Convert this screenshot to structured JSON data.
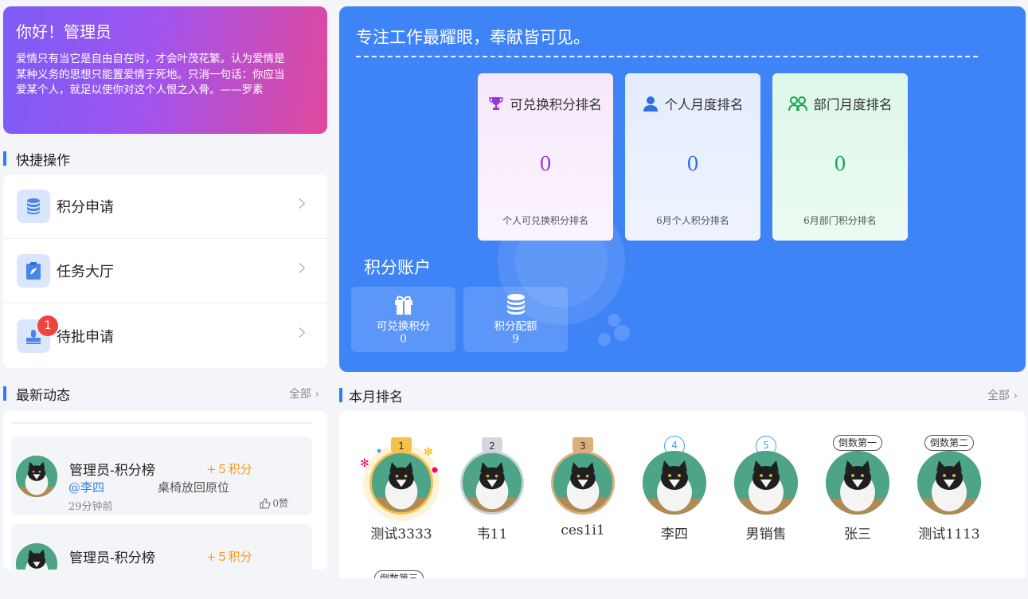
{
  "greeting": {
    "title": "你好！管理员",
    "quote": "爱情只有当它是自由自在时，才会叶茂花繁。认为爱情是某种义务的思想只能置爱情于死地。只消一句话：你应当爱某个人，就足以使你对这个人恨之入骨。——罗素"
  },
  "quick": {
    "title": "快捷操作",
    "items": [
      {
        "label": "积分申请",
        "icon": "database-icon"
      },
      {
        "label": "任务大厅",
        "icon": "task-icon"
      },
      {
        "label": "待批申请",
        "icon": "stamp-icon",
        "badge": "1"
      }
    ]
  },
  "news": {
    "title": "最新动态",
    "more": "全部",
    "items": [
      {
        "name": "管理员-积分榜",
        "points": "+５积分",
        "mention": "@李四",
        "content": "桌椅放回原位",
        "time": "29分钟前",
        "likes": "0赞"
      },
      {
        "name": "管理员-积分榜",
        "points": "+５积分"
      }
    ]
  },
  "hero": {
    "slogan": "专注工作最耀眼，奉献皆可见。",
    "cards": [
      {
        "title": "可兑换积分排名",
        "value": "0",
        "sub": "个人可兑换积分排名",
        "icon": "trophy-icon",
        "color": "#9b34d6"
      },
      {
        "title": "个人月度排名",
        "value": "0",
        "sub": "6月个人积分排名",
        "icon": "user-icon",
        "color": "#2f6fe0"
      },
      {
        "title": "部门月度排名",
        "value": "0",
        "sub": "6月部门积分排名",
        "icon": "group-icon",
        "color": "#1aa157"
      }
    ],
    "account_title": "积分账户",
    "account": [
      {
        "label": "可兑换积分",
        "value": "0",
        "icon": "gift-icon"
      },
      {
        "label": "积分配额",
        "value": "9",
        "icon": "coins-icon"
      }
    ]
  },
  "ranking": {
    "title": "本月排名",
    "more": "全部",
    "people": [
      {
        "name": "测试3333",
        "tag": "1"
      },
      {
        "name": "韦11",
        "tag": "2"
      },
      {
        "name": "ces1i1",
        "tag": "3"
      },
      {
        "name": "李四",
        "tag": "4"
      },
      {
        "name": "男销售",
        "tag": "5"
      },
      {
        "name": "张三",
        "tag": "倒数第一"
      },
      {
        "name": "测试1113",
        "tag": "倒数第二"
      }
    ],
    "partial_tag": "倒数第三"
  }
}
